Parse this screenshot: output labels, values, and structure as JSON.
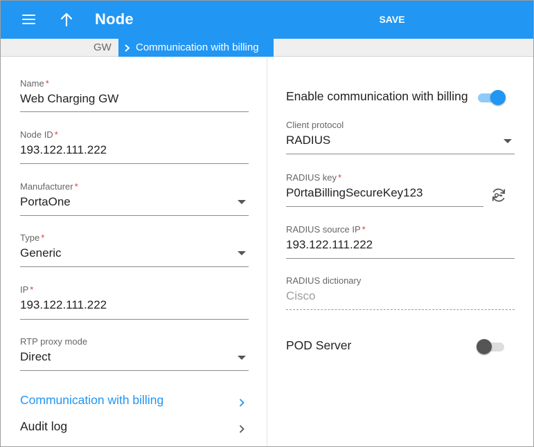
{
  "header": {
    "title": "Node",
    "save_label": "SAVE"
  },
  "breadcrumb": {
    "parent": "GW",
    "current": "Communication with billing"
  },
  "left": {
    "name": {
      "label": "Name",
      "value": "Web Charging GW"
    },
    "node_id": {
      "label": "Node ID",
      "value": "193.122.111.222"
    },
    "manufacturer": {
      "label": "Manufacturer",
      "value": "PortaOne"
    },
    "type": {
      "label": "Type",
      "value": "Generic"
    },
    "ip": {
      "label": "IP",
      "value": "193.122.111.222"
    },
    "rtp_proxy": {
      "label": "RTP proxy mode",
      "value": "Direct"
    },
    "nav": {
      "comm_billing": "Communication with billing",
      "audit_log": "Audit log"
    }
  },
  "right": {
    "enable_comm": {
      "label": "Enable communication with billing",
      "on": true
    },
    "client_protocol": {
      "label": "Client protocol",
      "value": "RADIUS"
    },
    "radius_key": {
      "label": "RADIUS key",
      "value": "P0rtaBillingSecureKey123"
    },
    "radius_source_ip": {
      "label": "RADIUS source IP",
      "value": "193.122.111.222"
    },
    "radius_dictionary": {
      "label": "RADIUS dictionary",
      "value": "Cisco"
    },
    "pod_server": {
      "label": "POD Server",
      "on": false
    }
  },
  "required_mark": "*",
  "colors": {
    "accent": "#2196f3",
    "required": "#e53935",
    "toggle_off_knob": "#555555",
    "toggle_off_track": "#dddddd"
  }
}
